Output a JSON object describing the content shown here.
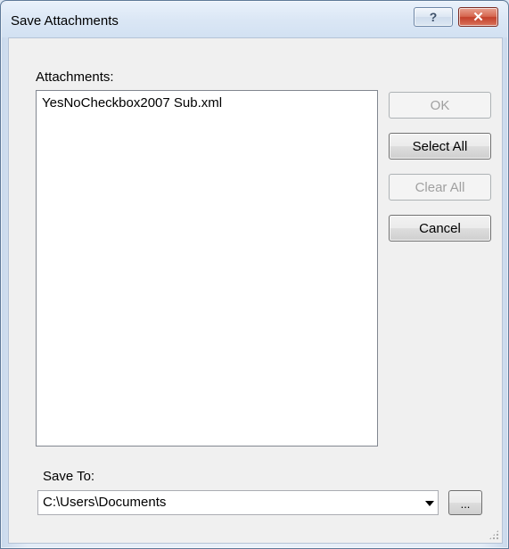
{
  "window": {
    "title": "Save Attachments",
    "help_glyph": "?",
    "close_glyph": "✕"
  },
  "attachments": {
    "label": "Attachments:",
    "items": [
      "YesNoCheckbox2007 Sub.xml"
    ]
  },
  "buttons": {
    "ok": "OK",
    "select_all": "Select All",
    "clear_all": "Clear All",
    "cancel": "Cancel",
    "browse": "..."
  },
  "save_to": {
    "label": "Save To:",
    "value": "C:\\Users\\Documents"
  }
}
